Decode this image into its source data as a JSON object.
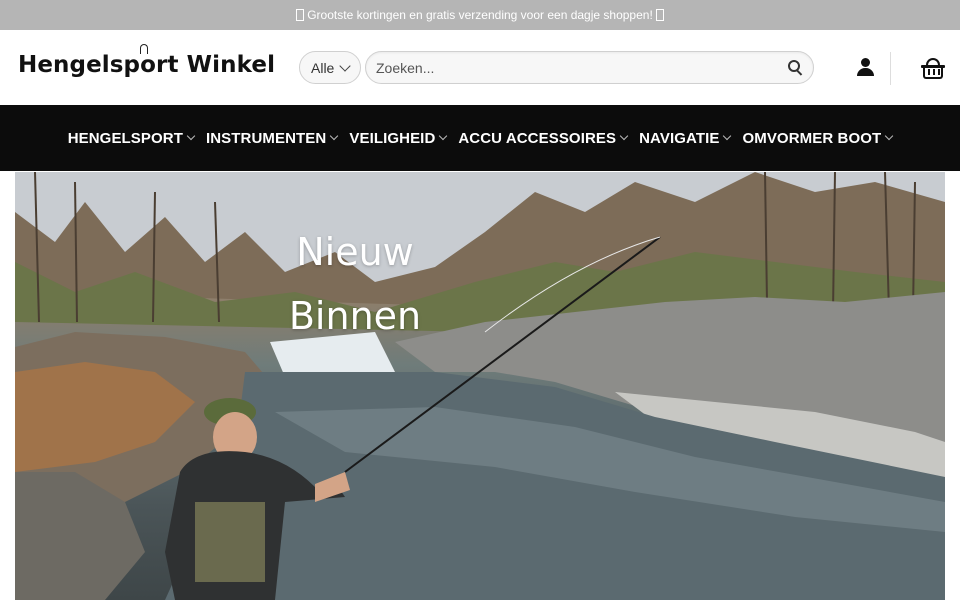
{
  "announcement": {
    "text": "Grootste kortingen en gratis verzending voor een dagje shoppen!"
  },
  "header": {
    "logo_text": "Hengelsport Winkel",
    "category_select": {
      "selected": "Alle"
    },
    "search": {
      "placeholder": "Zoeken..."
    },
    "icons": [
      "search-icon",
      "account-icon",
      "basket-icon"
    ]
  },
  "nav": {
    "items": [
      {
        "label": "HENGELSPORT"
      },
      {
        "label": "INSTRUMENTEN"
      },
      {
        "label": "VEILIGHEID"
      },
      {
        "label": "ACCU ACCESSOIRES"
      },
      {
        "label": "NAVIGATIE"
      },
      {
        "label": "OMVORMER BOOT"
      }
    ]
  },
  "hero": {
    "title_line1": "Nieuw",
    "title_line2": "Binnen"
  },
  "colors": {
    "topbar_bg": "#b5b5b5",
    "nav_bg": "#0c0c0c",
    "text_white": "#ffffff"
  }
}
